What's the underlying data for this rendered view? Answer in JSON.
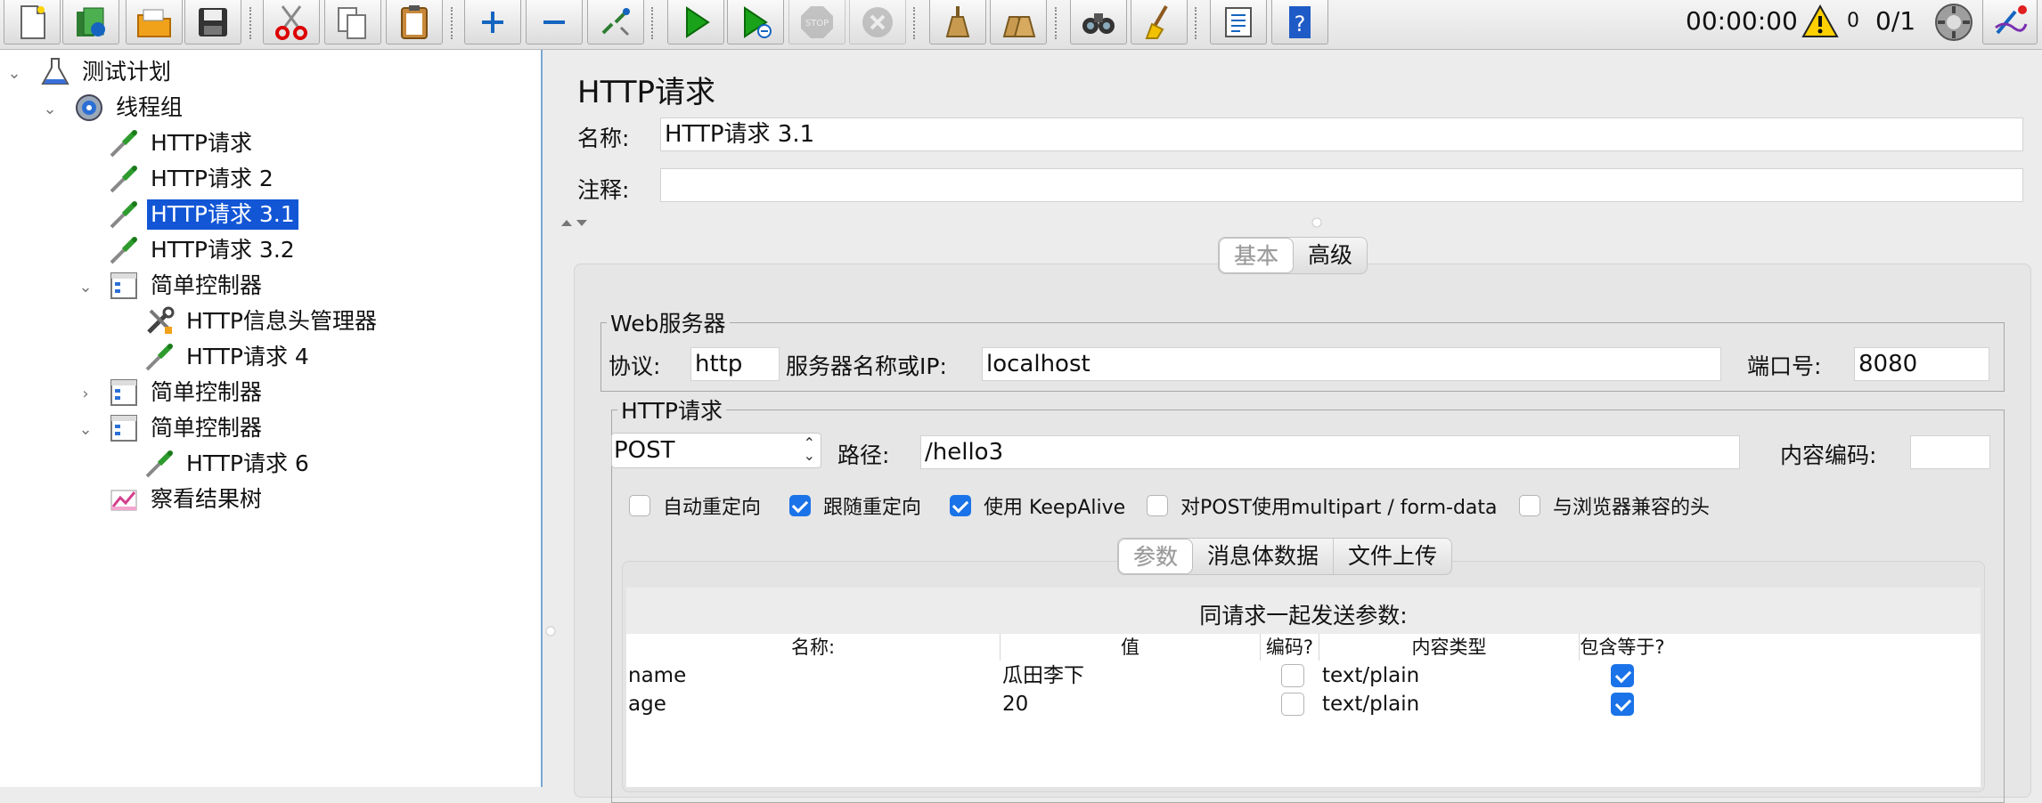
{
  "toolbar": {
    "buttons": [
      {
        "name": "new-icon"
      },
      {
        "name": "templates-icon"
      },
      {
        "name": "open-icon"
      },
      {
        "name": "save-icon"
      },
      {
        "name": "cut-icon"
      },
      {
        "name": "copy-icon"
      },
      {
        "name": "paste-icon"
      },
      {
        "name": "expand-icon"
      },
      {
        "name": "collapse-icon"
      },
      {
        "name": "toggle-icon"
      },
      {
        "name": "start-icon"
      },
      {
        "name": "start-no-pause-icon"
      },
      {
        "name": "stop-icon"
      },
      {
        "name": "shutdown-icon"
      },
      {
        "name": "clear-icon"
      },
      {
        "name": "clear-all-icon"
      },
      {
        "name": "search-icon"
      },
      {
        "name": "reset-search-icon"
      },
      {
        "name": "function-helper-icon"
      },
      {
        "name": "help-icon"
      }
    ],
    "stop_label": "STOP",
    "elapsed": "00:00:00",
    "warnings": "0",
    "threads": "0/1"
  },
  "tree": {
    "items": [
      {
        "label": "测试计划",
        "icon": "test-plan-icon"
      },
      {
        "label": "线程组",
        "icon": "thread-group-icon"
      },
      {
        "label": "HTTP请求",
        "icon": "http-sampler-icon"
      },
      {
        "label": "HTTP请求 2",
        "icon": "http-sampler-icon"
      },
      {
        "label": "HTTP请求 3.1",
        "icon": "http-sampler-icon",
        "selected": true
      },
      {
        "label": "HTTP请求 3.2",
        "icon": "http-sampler-icon"
      },
      {
        "label": "简单控制器",
        "icon": "simple-controller-icon"
      },
      {
        "label": "HTTP信息头管理器",
        "icon": "header-manager-icon"
      },
      {
        "label": "HTTP请求 4",
        "icon": "http-sampler-icon"
      },
      {
        "label": "简单控制器",
        "icon": "simple-controller-icon"
      },
      {
        "label": "简单控制器",
        "icon": "simple-controller-icon"
      },
      {
        "label": "HTTP请求 6",
        "icon": "http-sampler-icon"
      },
      {
        "label": "察看结果树",
        "icon": "results-tree-icon"
      }
    ]
  },
  "panel": {
    "title": "HTTP请求",
    "name_label": "名称:",
    "name_value": "HTTP请求 3.1",
    "comment_label": "注释:",
    "comment_value": "",
    "tabs": [
      "基本",
      "高级"
    ],
    "web_server": {
      "legend": "Web服务器",
      "protocol_label": "协议:",
      "protocol_value": "http",
      "server_label": "服务器名称或IP:",
      "server_value": "localhost",
      "port_label": "端口号:",
      "port_value": "8080"
    },
    "http_request": {
      "legend": "HTTP请求",
      "method": "POST",
      "path_label": "路径:",
      "path_value": "/hello3",
      "encoding_label": "内容编码:",
      "encoding_value": "",
      "options": [
        {
          "label": "自动重定向",
          "checked": false
        },
        {
          "label": "跟随重定向",
          "checked": true
        },
        {
          "label": "使用 KeepAlive",
          "checked": true
        },
        {
          "label": "对POST使用multipart / form-data",
          "checked": false
        },
        {
          "label": "与浏览器兼容的头",
          "checked": false
        }
      ],
      "subtabs": [
        "参数",
        "消息体数据",
        "文件上传"
      ],
      "params_title": "同请求一起发送参数:",
      "columns": [
        "名称:",
        "值",
        "编码?",
        "内容类型",
        "包含等于?"
      ],
      "rows": [
        {
          "name": "name",
          "value": "瓜田李下",
          "encode": false,
          "content_type": "text/plain",
          "include_equals": true
        },
        {
          "name": "age",
          "value": "20",
          "encode": false,
          "content_type": "text/plain",
          "include_equals": true
        }
      ]
    }
  }
}
